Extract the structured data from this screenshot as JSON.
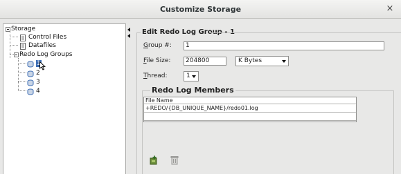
{
  "window": {
    "title": "Customize Storage",
    "close_glyph": "×"
  },
  "tree": {
    "root": "Storage",
    "items": [
      "Control Files",
      "Datafiles"
    ],
    "group_node": "Redo Log Groups",
    "groups": [
      "1",
      "2",
      "3",
      "4"
    ],
    "selected_group": "1"
  },
  "form": {
    "heading": "Edit Redo Log Group - 1",
    "group_label_first": "G",
    "group_label_rest": "roup #:",
    "group_value": "1",
    "size_label_first": "F",
    "size_label_rest": "ile Size:",
    "size_value": "204800",
    "unit_value": "K Bytes",
    "thread_label_first": "T",
    "thread_label_rest": "hread:",
    "thread_value": "1"
  },
  "members": {
    "heading": "Redo Log Members",
    "columns": [
      "File Name"
    ],
    "rows": [
      "+REDO/{DB_UNIQUE_NAME}/redo01.log",
      ""
    ]
  },
  "icons": {
    "add": "add-member-icon",
    "delete": "delete-member-icon",
    "tree_doc": "document-icon",
    "tree_db": "log-file-icon",
    "accent": "#3f6fb5"
  }
}
